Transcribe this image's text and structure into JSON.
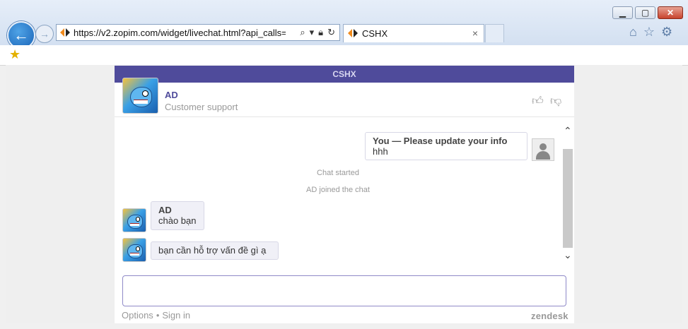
{
  "browser": {
    "url_scheme": "https://",
    "url_host": "v2.zopim.com",
    "url_path": "/widget/livechat.html?api_calls=",
    "tab_title": "CSHX",
    "tab_close": "×"
  },
  "widget": {
    "header_title": "CSHX",
    "agent_name": "AD",
    "agent_role": "Customer support",
    "messages": {
      "visitor_sender": "You — Please update your info",
      "visitor_text": "hhh",
      "system_started": "Chat started",
      "system_joined": "AD joined the chat",
      "agent_sender": "AD",
      "agent_text1": "chào bạn",
      "agent_text2": "bạn cần hỗ trợ vấn đề gì ạ"
    },
    "input_value": "",
    "footer_options": "Options",
    "footer_dot": "•",
    "footer_signin": "Sign in",
    "brand": "zendesk"
  }
}
